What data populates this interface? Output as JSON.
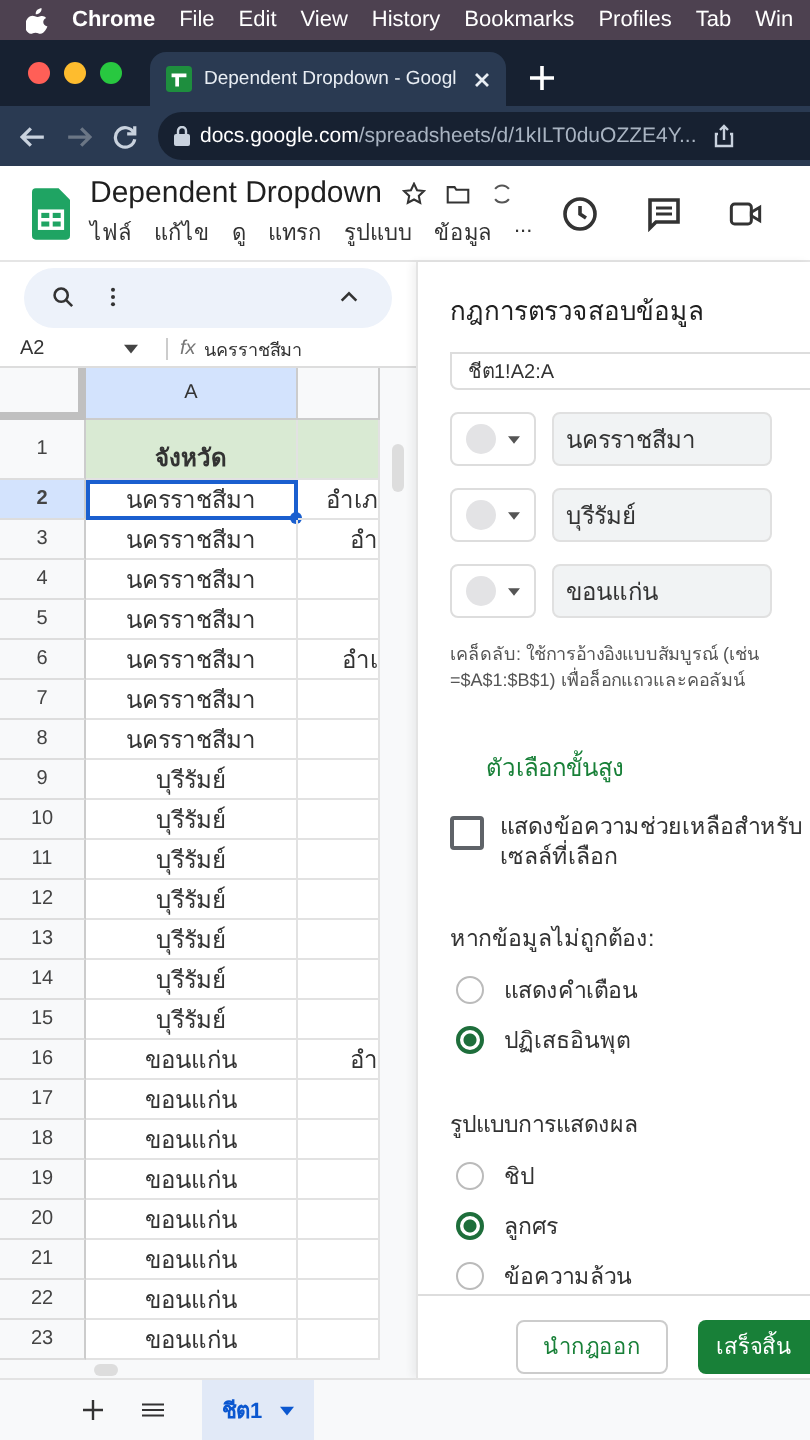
{
  "mac_menubar": {
    "items": [
      "Chrome",
      "File",
      "Edit",
      "View",
      "History",
      "Bookmarks",
      "Profiles",
      "Tab",
      "Win"
    ]
  },
  "browser": {
    "tab_title": "Dependent Dropdown - Googl",
    "url_host": "docs.google.com",
    "url_path": "/spreadsheets/d/1kILT0duOZZE4Y..."
  },
  "doc": {
    "title": "Dependent Dropdown",
    "menus": [
      "ไฟล์",
      "แก้ไข",
      "ดู",
      "แทรก",
      "รูปแบบ",
      "ข้อมูล",
      "..."
    ]
  },
  "formula_bar": {
    "name_box": "A2",
    "fx_label": "fx",
    "formula": "นครราชสีมา"
  },
  "columns": [
    "A"
  ],
  "rows": [
    {
      "number": "1",
      "kind": "header",
      "selected": false,
      "cells": [
        "จังหวัด",
        ""
      ]
    },
    {
      "number": "2",
      "kind": "data",
      "selected": true,
      "cells": [
        "นครราชสีมา",
        "อำเภ"
      ]
    },
    {
      "number": "3",
      "kind": "data",
      "selected": false,
      "cells": [
        "นครราชสีมา",
        "อำ"
      ]
    },
    {
      "number": "4",
      "kind": "data",
      "selected": false,
      "cells": [
        "นครราชสีมา",
        ""
      ]
    },
    {
      "number": "5",
      "kind": "data",
      "selected": false,
      "cells": [
        "นครราชสีมา",
        ""
      ]
    },
    {
      "number": "6",
      "kind": "data",
      "selected": false,
      "cells": [
        "นครราชสีมา",
        "อำเ"
      ]
    },
    {
      "number": "7",
      "kind": "data",
      "selected": false,
      "cells": [
        "นครราชสีมา",
        ""
      ]
    },
    {
      "number": "8",
      "kind": "data",
      "selected": false,
      "cells": [
        "นครราชสีมา",
        ""
      ]
    },
    {
      "number": "9",
      "kind": "data",
      "selected": false,
      "cells": [
        "บุรีรัมย์",
        ""
      ]
    },
    {
      "number": "10",
      "kind": "data",
      "selected": false,
      "cells": [
        "บุรีรัมย์",
        ""
      ]
    },
    {
      "number": "11",
      "kind": "data",
      "selected": false,
      "cells": [
        "บุรีรัมย์",
        ""
      ]
    },
    {
      "number": "12",
      "kind": "data",
      "selected": false,
      "cells": [
        "บุรีรัมย์",
        ""
      ]
    },
    {
      "number": "13",
      "kind": "data",
      "selected": false,
      "cells": [
        "บุรีรัมย์",
        ""
      ]
    },
    {
      "number": "14",
      "kind": "data",
      "selected": false,
      "cells": [
        "บุรีรัมย์",
        ""
      ]
    },
    {
      "number": "15",
      "kind": "data",
      "selected": false,
      "cells": [
        "บุรีรัมย์",
        ""
      ]
    },
    {
      "number": "16",
      "kind": "data",
      "selected": false,
      "cells": [
        "ขอนแก่น",
        "อำ"
      ]
    },
    {
      "number": "17",
      "kind": "data",
      "selected": false,
      "cells": [
        "ขอนแก่น",
        ""
      ]
    },
    {
      "number": "18",
      "kind": "data",
      "selected": false,
      "cells": [
        "ขอนแก่น",
        ""
      ]
    },
    {
      "number": "19",
      "kind": "data",
      "selected": false,
      "cells": [
        "ขอนแก่น",
        ""
      ]
    },
    {
      "number": "20",
      "kind": "data",
      "selected": false,
      "cells": [
        "ขอนแก่น",
        ""
      ]
    },
    {
      "number": "21",
      "kind": "data",
      "selected": false,
      "cells": [
        "ขอนแก่น",
        ""
      ]
    },
    {
      "number": "22",
      "kind": "data",
      "selected": false,
      "cells": [
        "ขอนแก่น",
        ""
      ]
    },
    {
      "number": "23",
      "kind": "data",
      "selected": false,
      "cells": [
        "ขอนแก่น",
        ""
      ]
    }
  ],
  "sheet_tabs": [
    {
      "label": "ชีต1",
      "selected": true
    }
  ],
  "panel": {
    "title": "กฎการตรวจสอบข้อมูล",
    "range": "ชีต1!A2:A",
    "items": [
      {
        "value": "นครราชสีมา"
      },
      {
        "value": "บุรีรัมย์"
      },
      {
        "value": "ขอนแก่น"
      }
    ],
    "hint": "เคล็ดลับ: ใช้การอ้างอิงแบบสัมบูรณ์ (เช่น =$A$1:$B$1) เพื่อล็อกแถวและคอลัมน์",
    "advanced_link": "ตัวเลือกขั้นสูง",
    "help_text_option": {
      "label": "แสดงข้อความช่วยเหลือสำหรับเซลล์ที่เลือก",
      "checked": false
    },
    "invalid_data": {
      "label": "หากข้อมูลไม่ถูกต้อง:",
      "options": [
        {
          "label": "แสดงคำเตือน",
          "selected": false
        },
        {
          "label": "ปฏิเสธอินพุต",
          "selected": true
        }
      ]
    },
    "display_style": {
      "label": "รูปแบบการแสดงผล",
      "options": [
        {
          "label": "ชิป",
          "selected": false
        },
        {
          "label": "ลูกศร",
          "selected": true
        },
        {
          "label": "ข้อความล้วน",
          "selected": false
        }
      ]
    },
    "buttons": [
      {
        "label": "นำกฎออก",
        "kind": "secondary"
      },
      {
        "label": "เสร็จสิ้น",
        "kind": "primary"
      }
    ]
  }
}
